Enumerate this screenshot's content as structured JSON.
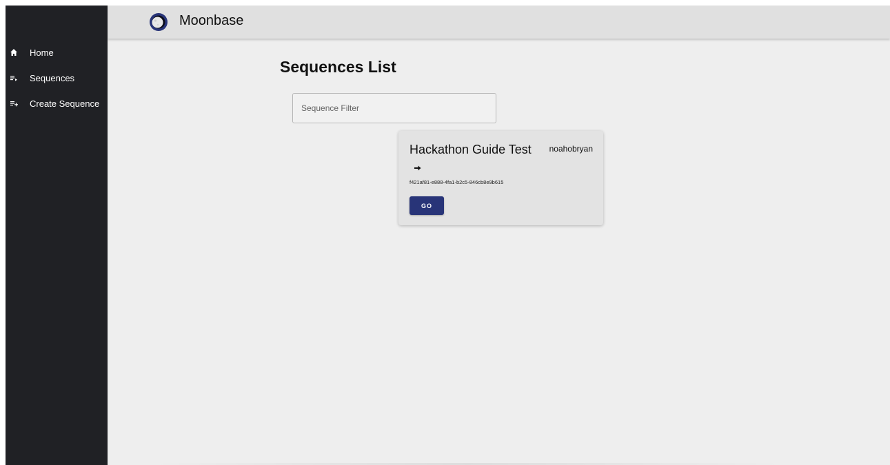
{
  "header": {
    "app_title": "Moonbase",
    "logo_icon": "moon-logo-icon"
  },
  "sidebar": {
    "items": [
      {
        "label": "Home",
        "icon": "home-icon"
      },
      {
        "label": "Sequences",
        "icon": "playlist-play-icon"
      },
      {
        "label": "Create Sequence",
        "icon": "playlist-add-icon"
      }
    ]
  },
  "main": {
    "title": "Sequences List",
    "filter": {
      "placeholder": "Sequence Filter",
      "value": ""
    },
    "cards": [
      {
        "title": "Hackathon Guide Test",
        "owner": "noahobryan",
        "arrow_icon": "arrow-right-icon",
        "id": "f421af81-e888-4fa1-b2c5-846cb8e9b615",
        "button_label": "GO"
      }
    ]
  },
  "colors": {
    "sidebar_bg": "#202125",
    "header_bg": "#e0e0e0",
    "page_bg": "#eeeeee",
    "card_bg": "#e3e3e3",
    "button_bg": "#283478",
    "logo_ring": "#283478"
  }
}
